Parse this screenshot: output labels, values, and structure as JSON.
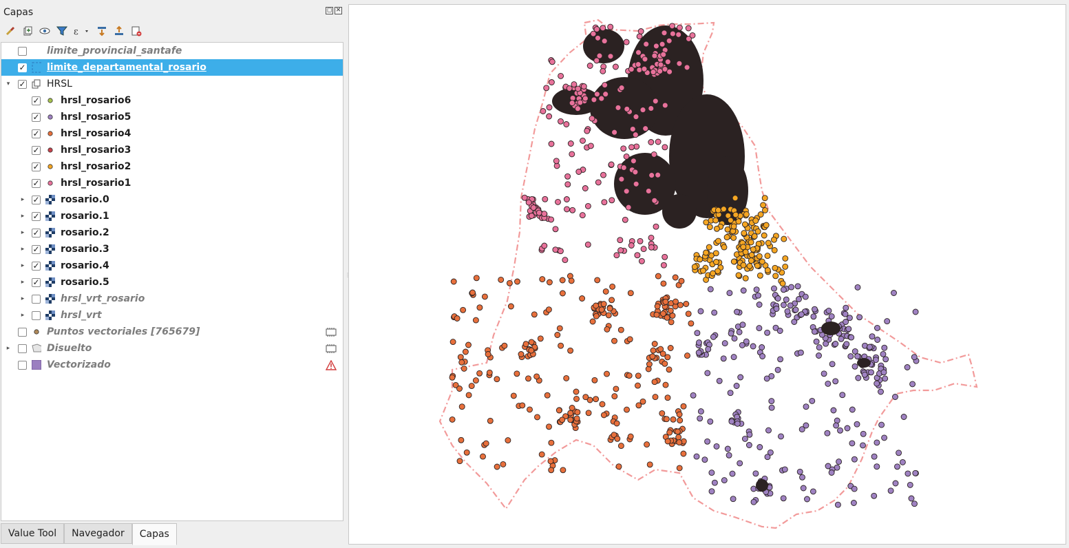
{
  "panel": {
    "title": "Capas",
    "toolbar": [
      {
        "icon": "style-brush-icon"
      },
      {
        "icon": "add-group-icon"
      },
      {
        "icon": "eye-visibility-icon"
      },
      {
        "icon": "filter-legend-icon"
      },
      {
        "icon": "filter-expression-icon"
      },
      {
        "icon": "expand-all-icon"
      },
      {
        "icon": "collapse-all-icon"
      },
      {
        "icon": "remove-layer-icon"
      }
    ],
    "layers": [
      {
        "name": "limite_provincial_santafe",
        "checked": false,
        "style": "gray",
        "symbol": "none",
        "indent": 0,
        "expander": false
      },
      {
        "name": "limite_departamental_rosario",
        "checked": true,
        "style": "sel",
        "symbol": "polygon-outline",
        "indent": 0,
        "expander": false,
        "selected": true
      },
      {
        "name": "HRSL",
        "checked": true,
        "style": "plain",
        "symbol": "group",
        "indent": 0,
        "expander": "open"
      },
      {
        "name": "hrsl_rosario6",
        "checked": true,
        "style": "bold",
        "symbol": "point",
        "color": "#a8c44e",
        "indent": 1,
        "expander": false
      },
      {
        "name": "hrsl_rosario5",
        "checked": true,
        "style": "bold",
        "symbol": "point",
        "color": "#9f82c2",
        "indent": 1,
        "expander": false
      },
      {
        "name": "hrsl_rosario4",
        "checked": true,
        "style": "bold",
        "symbol": "point",
        "color": "#e8703c",
        "indent": 1,
        "expander": false
      },
      {
        "name": "hrsl_rosario3",
        "checked": true,
        "style": "bold",
        "symbol": "point",
        "color": "#c8434c",
        "indent": 1,
        "expander": false
      },
      {
        "name": "hrsl_rosario2",
        "checked": true,
        "style": "bold",
        "symbol": "point",
        "color": "#f5a623",
        "indent": 1,
        "expander": false
      },
      {
        "name": "hrsl_rosario1",
        "checked": true,
        "style": "bold",
        "symbol": "point",
        "color": "#e8729b",
        "indent": 1,
        "expander": false
      },
      {
        "name": "rosario.0",
        "checked": true,
        "style": "bold",
        "symbol": "raster",
        "indent": 1,
        "expander": "closed"
      },
      {
        "name": "rosario.1",
        "checked": true,
        "style": "bold",
        "symbol": "raster",
        "indent": 1,
        "expander": "closed"
      },
      {
        "name": "rosario.2",
        "checked": true,
        "style": "bold",
        "symbol": "raster",
        "indent": 1,
        "expander": "closed"
      },
      {
        "name": "rosario.3",
        "checked": true,
        "style": "bold",
        "symbol": "raster",
        "indent": 1,
        "expander": "closed"
      },
      {
        "name": "rosario.4",
        "checked": true,
        "style": "bold",
        "symbol": "raster",
        "indent": 1,
        "expander": "closed"
      },
      {
        "name": "rosario.5",
        "checked": true,
        "style": "bold",
        "symbol": "raster",
        "indent": 1,
        "expander": "closed"
      },
      {
        "name": "hrsl_vrt_rosario",
        "checked": false,
        "style": "gray",
        "symbol": "raster",
        "indent": 1,
        "expander": "closed"
      },
      {
        "name": "hrsl_vrt",
        "checked": false,
        "style": "gray",
        "symbol": "raster",
        "indent": 1,
        "expander": "closed"
      },
      {
        "name": "Puntos vectoriales [765679]",
        "checked": false,
        "style": "gray",
        "symbol": "point",
        "color": "#b08a5a",
        "indent": 0,
        "expander": false,
        "indicator": "memory-layer-icon"
      },
      {
        "name": "Disuelto",
        "checked": false,
        "style": "gray",
        "symbol": "polygon-gray",
        "indent": 0,
        "expander": "closed",
        "indicator": "memory-layer-icon"
      },
      {
        "name": "Vectorizado",
        "checked": false,
        "style": "gray",
        "symbol": "polygon-purple",
        "indent": 0,
        "expander": false,
        "indicator": "warning-icon"
      }
    ]
  },
  "tabs": [
    {
      "label": "Value Tool",
      "active": false
    },
    {
      "label": "Navegador",
      "active": false
    },
    {
      "label": "Capas",
      "active": true
    }
  ],
  "map": {
    "boundary_color": "#f29a9a",
    "point_stroke": "#2a2222",
    "clusters": [
      {
        "color": "#e8729b",
        "dense_color": "#2b2222"
      },
      {
        "color": "#f5a623"
      },
      {
        "color": "#e8703c"
      },
      {
        "color": "#9f82c2"
      }
    ]
  }
}
